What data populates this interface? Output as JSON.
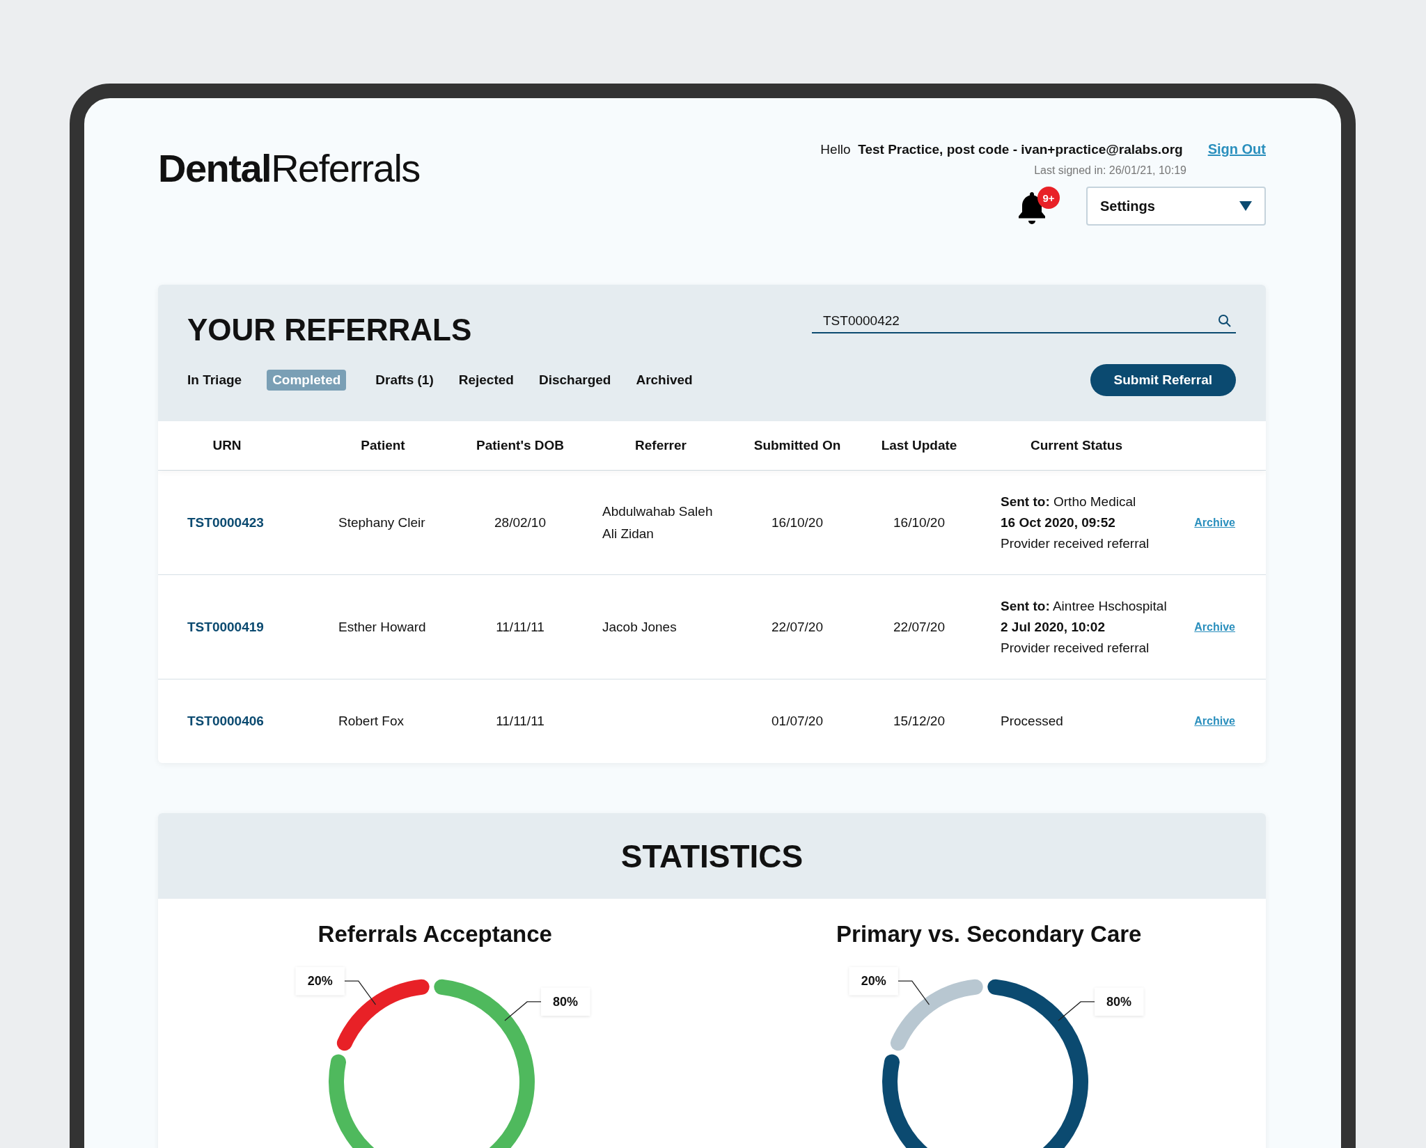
{
  "logo": "**Dental**Referrals",
  "account": {
    "greeting": "Hello",
    "user": "Test Practice, post code - ivan+practice@ralabs.org",
    "sign_out": "Sign Out",
    "last_signed": "Last signed in: 26/01/21, 10:19"
  },
  "notifications": {
    "badge": "9+"
  },
  "settings": {
    "label": "Settings"
  },
  "referrals": {
    "title": "YOUR REFERRALS",
    "search": {
      "value": "TST0000422"
    },
    "tabs": [
      {
        "label": "In Triage",
        "selected": false
      },
      {
        "label": "Completed",
        "selected": true
      },
      {
        "label": "Drafts (1)",
        "selected": false
      },
      {
        "label": "Rejected",
        "selected": false
      },
      {
        "label": "Discharged",
        "selected": false
      },
      {
        "label": "Archived",
        "selected": false
      }
    ],
    "submit_button": "Submit Referral",
    "columns": [
      "URN",
      "Patient",
      "Patient's DOB",
      "Referrer",
      "Submitted On",
      "Last Update",
      "Current Status"
    ],
    "rows": [
      {
        "urn": "TST0000423",
        "patient": "Stephany Cleir",
        "dob": "28/02/10",
        "referrer": "Abdulwahab Saleh Ali Zidan",
        "submitted": "16/10/20",
        "updated": "16/10/20",
        "status": [
          {
            "kind": "sent",
            "text": "**Sent to:**  Ortho Medical"
          },
          {
            "kind": "date",
            "text": "16 Oct 2020, 09:52"
          },
          {
            "kind": "note",
            "text": "Provider received referral"
          }
        ],
        "action": "Archive"
      },
      {
        "urn": "TST0000419",
        "patient": "Esther Howard",
        "dob": "11/11/11",
        "referrer": "Jacob Jones",
        "submitted": "22/07/20",
        "updated": "22/07/20",
        "status": [
          {
            "kind": "sent",
            "text": "**Sent to:**  Aintree Hschospital"
          },
          {
            "kind": "date",
            "text": "2 Jul 2020, 10:02"
          },
          {
            "kind": "note",
            "text": "Provider received referral"
          }
        ],
        "action": "Archive"
      },
      {
        "urn": "TST0000406",
        "patient": "Robert Fox",
        "dob": "11/11/11",
        "submitted": "01/07/20",
        "updated": "15/12/20",
        "status": [
          {
            "kind": "note",
            "text": "Processed"
          }
        ],
        "action": "Archive"
      }
    ]
  },
  "statistics": {
    "title": "STATISTICS",
    "charts": [
      {
        "chart_data": {
          "type": "donut",
          "title": "Referrals Acceptance",
          "values": [
            20,
            80
          ],
          "colors": [
            "#e82127",
            "#4fb95d"
          ],
          "value_labels": [
            "20%",
            "80%"
          ]
        }
      },
      {
        "chart_data": {
          "type": "donut",
          "title": "Primary vs. Secondary Care",
          "values": [
            20,
            80
          ],
          "colors": [
            "#b8c7d1",
            "#0b4a70"
          ],
          "value_labels": [
            "20%",
            "80%"
          ]
        }
      }
    ]
  }
}
